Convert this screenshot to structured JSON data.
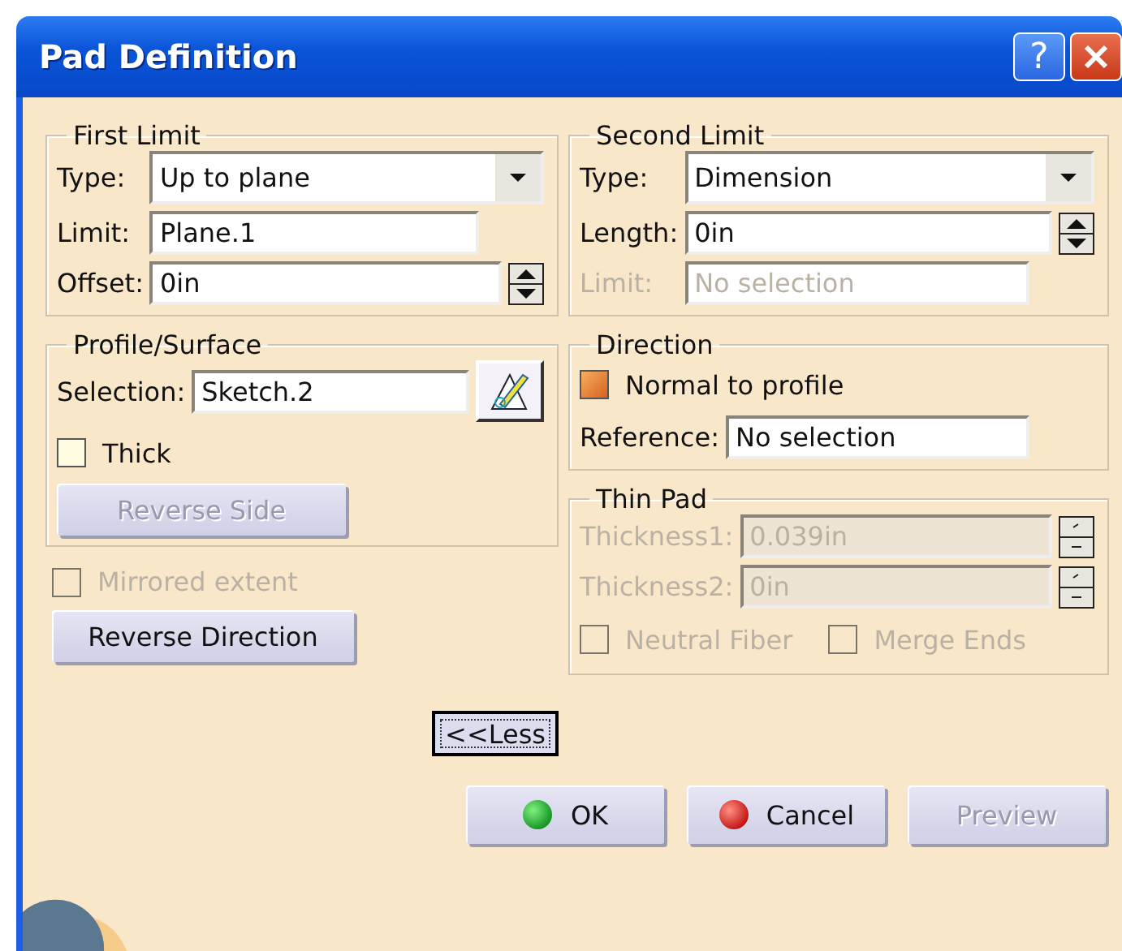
{
  "window": {
    "title": "Pad Definition",
    "help_label": "?"
  },
  "left_column": [
    {
      "kind": "group",
      "title": "First Limit",
      "rows": [
        {
          "kind": "dropdown",
          "label": "Type:",
          "value": "Up to plane",
          "disabled": false
        },
        {
          "kind": "field",
          "label": "Limit:",
          "value": "Plane.1",
          "disabled": false
        },
        {
          "kind": "spinner",
          "label": "Offset:",
          "value": "0in",
          "disabled": false
        }
      ]
    },
    {
      "kind": "group",
      "title": "Profile/Surface",
      "rows": [
        {
          "kind": "selection",
          "label": "Selection:",
          "value": "Sketch.2",
          "disabled": false
        },
        {
          "kind": "checkbox",
          "label": "Thick",
          "checked": false,
          "disabled": false
        },
        {
          "kind": "button",
          "label": "Reverse Side",
          "disabled": true
        }
      ]
    },
    {
      "kind": "checkbox",
      "label": "Mirrored extent",
      "checked": false,
      "disabled": true
    },
    {
      "kind": "button",
      "label": "Reverse Direction",
      "disabled": false
    },
    {
      "kind": "less-button",
      "label": "<<Less",
      "focused": true
    }
  ],
  "right_column": [
    {
      "kind": "group",
      "title": "Second Limit",
      "rows": [
        {
          "kind": "dropdown",
          "label": "Type:",
          "value": "Dimension",
          "disabled": false
        },
        {
          "kind": "spinner",
          "label": "Length:",
          "value": "0in",
          "disabled": false
        },
        {
          "kind": "field",
          "label": "Limit:",
          "value": "No selection",
          "disabled": true
        }
      ]
    },
    {
      "kind": "group",
      "title": "Direction",
      "rows": [
        {
          "kind": "checkbox",
          "label": "Normal to profile",
          "checked": true,
          "disabled": false
        },
        {
          "kind": "field",
          "label": "Reference:",
          "value": "No selection",
          "disabled": false
        }
      ]
    },
    {
      "kind": "group",
      "title": "Thin Pad",
      "rows": [
        {
          "kind": "spinner",
          "label": "Thickness1:",
          "value": "0.039in",
          "disabled": true
        },
        {
          "kind": "spinner",
          "label": "Thickness2:",
          "value": "0in",
          "disabled": true
        },
        {
          "kind": "checkbox-pair",
          "items": [
            {
              "label": "Neutral Fiber",
              "checked": false,
              "disabled": true
            },
            {
              "label": "Merge Ends",
              "checked": false,
              "disabled": true
            }
          ]
        }
      ]
    }
  ],
  "footer_buttons": [
    {
      "kind": "ok",
      "label": "OK",
      "disabled": false
    },
    {
      "kind": "cancel",
      "label": "Cancel",
      "disabled": false
    },
    {
      "kind": "plain",
      "label": "Preview",
      "disabled": true
    }
  ]
}
